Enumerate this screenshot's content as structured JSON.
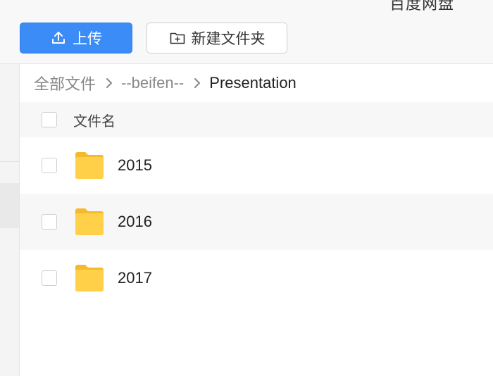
{
  "header": {
    "app_title": "百度网盘",
    "upload_label": "上传",
    "new_folder_label": "新建文件夹"
  },
  "breadcrumb": {
    "items": [
      "全部文件",
      "--beifen--",
      "Presentation"
    ]
  },
  "list": {
    "column_name": "文件名",
    "rows": [
      {
        "name": "2015",
        "type": "folder-icon"
      },
      {
        "name": "2016",
        "type": "folder-icon"
      },
      {
        "name": "2017",
        "type": "folder-icon"
      }
    ]
  },
  "colors": {
    "accent": "#3b8cf7",
    "folder": "#ffcd45"
  }
}
